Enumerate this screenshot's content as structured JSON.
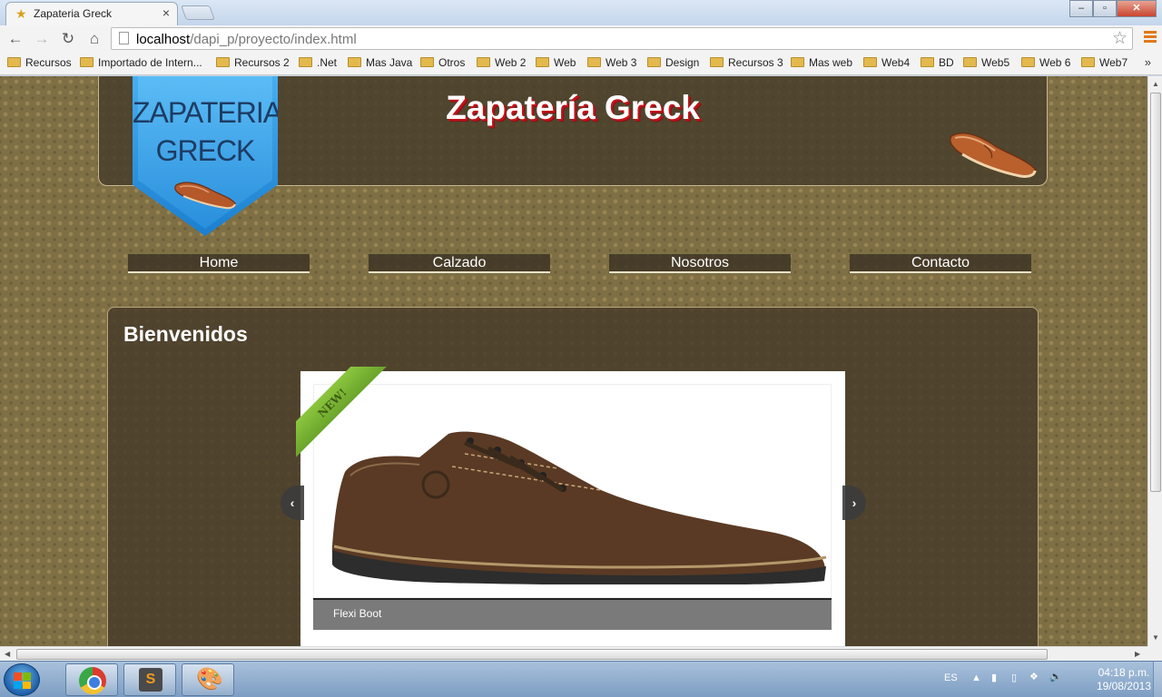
{
  "browser": {
    "tab_title": "Zapateria Greck",
    "tab_close": "×",
    "url_host": "localhost",
    "url_path": "/dapi_p/proyecto/index.html",
    "bookmarks": [
      "Recursos",
      "Importado de Intern...",
      "Recursos 2",
      ".Net",
      "Mas Java",
      "Otros",
      "Web 2",
      "Web",
      "Web 3",
      "Design",
      "Recursos 3",
      "Mas web",
      "Web4",
      "BD",
      "Web5",
      "Web 6",
      "Web7"
    ],
    "bookmarks_more": "»"
  },
  "site": {
    "logo_line1": "ZAPATERIA",
    "logo_line2": "GRECK",
    "title": "Zapatería Greck",
    "nav": [
      "Home",
      "Calzado",
      "Nosotros",
      "Contacto"
    ],
    "heading": "Bienvenidos",
    "slider": {
      "ribbon": "NEW!",
      "caption": "Flexi Boot",
      "prev": "‹",
      "next": "›"
    }
  },
  "taskbar": {
    "language": "ES",
    "time": "04:18 p.m.",
    "date": "19/08/2013"
  },
  "colors": {
    "title_shadow": "#c0141a",
    "logo_blue": "#2a8fdc",
    "ribbon_green": "#8cc63f",
    "page_bg": "#7f6f45"
  }
}
